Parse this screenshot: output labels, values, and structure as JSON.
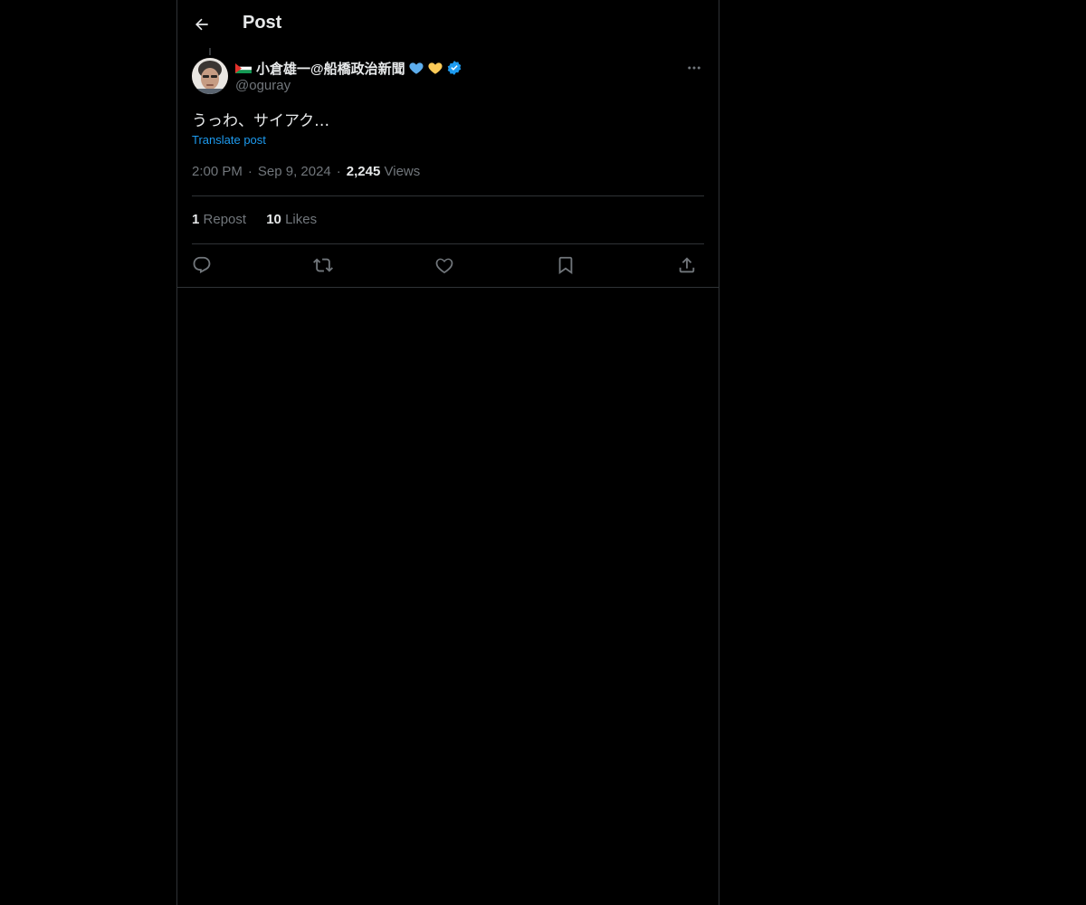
{
  "header": {
    "back_icon": "arrow-left-icon",
    "title": "Post"
  },
  "post": {
    "author": {
      "display_name": "小倉雄一@船橋政治新聞",
      "handle": "@oguray",
      "flag_icon": "palestine-flag-icon",
      "emoji_icons": [
        "blue-heart-icon",
        "yellow-heart-icon"
      ],
      "verified_icon": "verified-badge-icon"
    },
    "text": "うっわ、サイアク…",
    "translate_label": "Translate post",
    "time": "2:00 PM",
    "date": "Sep 9, 2024",
    "views_count": "2,245",
    "views_label": "Views",
    "reposts_count": "1",
    "reposts_label": "Repost",
    "likes_count": "10",
    "likes_label": "Likes"
  },
  "actions": [
    "reply-icon",
    "repost-icon",
    "like-icon",
    "bookmark-icon",
    "share-icon"
  ],
  "colors": {
    "background": "#000000",
    "text": "#e7e9ea",
    "muted": "#71767b",
    "link": "#1d9bf0",
    "border": "#2f3336"
  }
}
